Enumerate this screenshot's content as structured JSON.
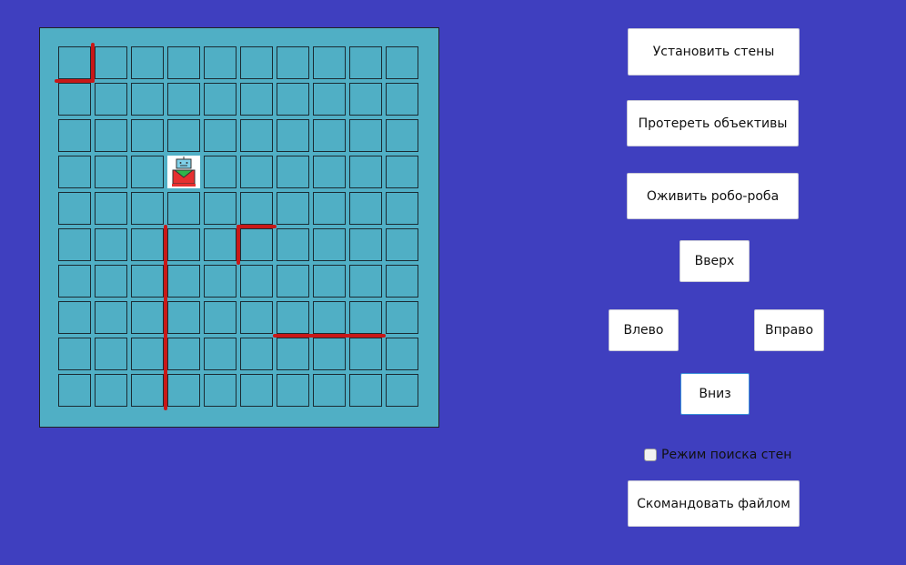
{
  "grid": {
    "rows": 10,
    "cols": 10,
    "robot": {
      "row": 3,
      "col": 3
    }
  },
  "walls": [
    {
      "orient": "v",
      "line": 1,
      "from": 0,
      "to": 1
    },
    {
      "orient": "h",
      "line": 1,
      "from": 0,
      "to": 1
    },
    {
      "orient": "v",
      "line": 3,
      "from": 5,
      "to": 10
    },
    {
      "orient": "h",
      "line": 5,
      "from": 5,
      "to": 6
    },
    {
      "orient": "v",
      "line": 5,
      "from": 5,
      "to": 6
    },
    {
      "orient": "h",
      "line": 8,
      "from": 6,
      "to": 9
    }
  ],
  "controls": {
    "set_walls": "Установить стены",
    "wipe_lenses": "Протереть объективы",
    "revive": "Оживить робо-роба",
    "up": "Вверх",
    "left": "Влево",
    "right": "Вправо",
    "down": "Вниз",
    "wall_search_label": "Режим поиска стен",
    "wall_search_checked": false,
    "command_file": "Скомандовать файлом"
  },
  "colors": {
    "background": "#3f3fbf",
    "board": "#50afc5",
    "wall": "#c81818"
  }
}
